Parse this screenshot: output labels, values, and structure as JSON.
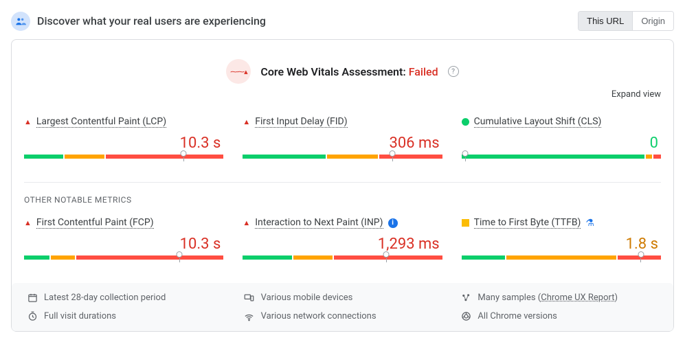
{
  "header": {
    "title": "Discover what your real users are experiencing",
    "toggle": {
      "url": "This URL",
      "origin": "Origin"
    }
  },
  "assessment": {
    "label": "Core Web Vitals Assessment:",
    "status": "Failed"
  },
  "expand_label": "Expand view",
  "metrics_primary": [
    {
      "name": "Largest Contentful Paint (LCP)",
      "value": "10.3 s",
      "status": "red",
      "segments": [
        20,
        20,
        60
      ],
      "marker": 80
    },
    {
      "name": "First Input Delay (FID)",
      "value": "306 ms",
      "status": "red",
      "segments": [
        42,
        26,
        32
      ],
      "marker": 75
    },
    {
      "name": "Cumulative Layout Shift (CLS)",
      "value": "0",
      "status": "green",
      "segments": [
        93,
        3,
        4
      ],
      "marker": 2,
      "dot_status": true
    }
  ],
  "section_label": "OTHER NOTABLE METRICS",
  "metrics_other": [
    {
      "name": "First Contentful Paint (FCP)",
      "value": "10.3 s",
      "status": "red",
      "segments": [
        13,
        12,
        75
      ],
      "marker": 78
    },
    {
      "name": "Interaction to Next Paint (INP)",
      "value": "1,293 ms",
      "status": "red",
      "segments": [
        25,
        20,
        55
      ],
      "marker": 72,
      "info": true
    },
    {
      "name": "Time to First Byte (TTFB)",
      "value": "1.8 s",
      "status": "orange",
      "segments": [
        22,
        56,
        22
      ],
      "marker": 90,
      "flask": true,
      "sq_status": true
    }
  ],
  "footer": {
    "col1": [
      {
        "icon": "calendar",
        "text": "Latest 28-day collection period"
      },
      {
        "icon": "timer",
        "text": "Full visit durations"
      }
    ],
    "col2": [
      {
        "icon": "devices",
        "text": "Various mobile devices"
      },
      {
        "icon": "network",
        "text": "Various network connections"
      }
    ],
    "col3": [
      {
        "icon": "samples",
        "text": "Many samples",
        "link": "Chrome UX Report"
      },
      {
        "icon": "chrome",
        "text": "All Chrome versions"
      }
    ]
  }
}
